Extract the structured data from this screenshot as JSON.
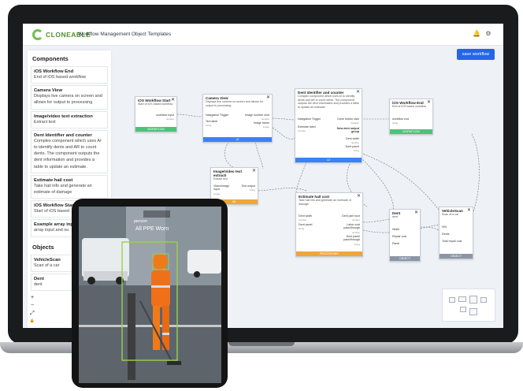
{
  "brand": {
    "name": "CLONEABLE",
    "accent": "#6fc24a",
    "primary": "#2566e8"
  },
  "nav": {
    "workflow_management": "Workflow Management",
    "object_templates": "Object Templates"
  },
  "icons": {
    "notifications": "bell-icon",
    "settings": "gear-icon"
  },
  "sidebar": {
    "components_heading": "Components",
    "objects_heading": "Objects",
    "components": [
      {
        "title": "iOS Workflow End",
        "desc": [
          "End of iOS based workflow"
        ]
      },
      {
        "title": "Camera View",
        "desc": [
          "Displays live camera on screen and",
          "allows for output to processing"
        ]
      },
      {
        "title": "Image/video text extraction",
        "desc": [
          "Extract text"
        ]
      },
      {
        "title": "Dent Identifier and counter",
        "desc": [
          "Complex component which uses AI",
          "to identify dents and AR to count",
          "dents. The component outputs the",
          "dent information and provides a",
          "table to update an estimate."
        ]
      },
      {
        "title": "Estimate hail cost",
        "desc": [
          "Take hail info and generate an",
          "estimate of damage"
        ]
      },
      {
        "title": "iOS Workflow Start",
        "desc": [
          "Start of iOS based"
        ]
      },
      {
        "title": "Example array inp",
        "desc": [
          "array input and ou"
        ]
      }
    ],
    "objects": [
      {
        "title": "VehicleScan",
        "desc": [
          "Scan of a car"
        ]
      },
      {
        "title": "Dent",
        "desc": [
          "dent"
        ]
      }
    ]
  },
  "zoom": {
    "in": "+",
    "out": "−",
    "fit": "⤢",
    "lock": "🔒"
  },
  "save_workflow": "save workflow",
  "nodes": {
    "ios_start": {
      "title": "iOS Workflow Start",
      "desc": "Start of iOS based workflow",
      "out1": "workflow input",
      "out1_type": "number",
      "foot": "WORKFLOW"
    },
    "camera": {
      "title": "Camera View",
      "desc": "Displays live camera on screen and allows for output to processing",
      "in1": "Navigation Trigger",
      "in2": "Text label",
      "in2_type": "string",
      "out1": "Image number shot",
      "out1_type": "number",
      "out2": "Image frame",
      "out2_type": "image",
      "foot": "UI"
    },
    "dent": {
      "title": "Dent Identifier and counter",
      "desc": "Complex component which uses AI to identify dents and AR to count dents. The component outputs the dent information and provides a table to update an estimate.",
      "in1": "Navigation Trigger",
      "in2": "Estimate label",
      "in2_type": "number",
      "out1": "Done button click",
      "out1_type": "boolean",
      "group": "New dent output group",
      "g1": "Dent width",
      "g1_type": "number",
      "g2": "Dent panel",
      "g2_type": "string",
      "foot": "UI"
    },
    "ios_end": {
      "title": "iOS Workflow End",
      "desc": "End of iOS based workflow",
      "in1": "workflow end",
      "in1_type": "string",
      "foot": "WORKFLOW"
    },
    "text_extract": {
      "title": "Image/video text extracti",
      "desc": "Extract text",
      "in1": "Video/Image input",
      "in1_type": "image",
      "out1": "Text output",
      "out1_type": "string",
      "foot": "ML"
    },
    "hail": {
      "title": "Estimate hail cost",
      "desc": "Take hail info and generate an estimate of damage",
      "in1": "Dent width",
      "in1_type": "number",
      "in2": "Dent panel",
      "in2_type": "string",
      "out1": "Dent part hour",
      "out1_type": "number",
      "out2": "Labor cost pass/through",
      "out2_type": "number",
      "out3": "Dent panel pass/through",
      "out3_type": "string",
      "foot": "PROCESSING"
    },
    "dent_obj": {
      "title": "Dent",
      "desc": "dent",
      "f1": "Width",
      "f2": "Repair cost",
      "f3": "Panel",
      "foot": "OBJECT"
    },
    "vehicle_obj": {
      "title": "VehicleScan",
      "desc": "Scan of a car",
      "f1": "VIN",
      "f2": "Dents",
      "f3": "Total repair cost",
      "foot": "OBJECT"
    }
  },
  "tablet": {
    "overlay_label": "All PPE Worn",
    "top_label": "person",
    "box_color": "#9bd14a"
  }
}
